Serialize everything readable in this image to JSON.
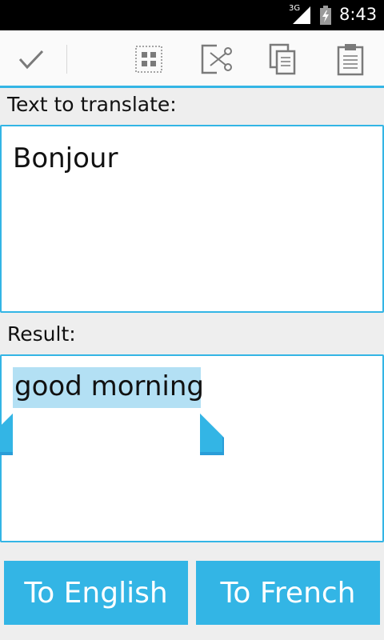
{
  "status_bar": {
    "network_label": "3G",
    "time": "8:43"
  },
  "action_bar": {
    "icons": [
      "check-icon",
      "select-all-icon",
      "cut-icon",
      "copy-icon",
      "paste-icon"
    ]
  },
  "source": {
    "label": "Text to translate:",
    "text": "Bonjour"
  },
  "result": {
    "label": "Result:",
    "text": "good morning"
  },
  "buttons": {
    "to_english": "To English",
    "to_french": "To French"
  },
  "colors": {
    "accent": "#33b5e5",
    "selection": "#b3e0f4"
  }
}
